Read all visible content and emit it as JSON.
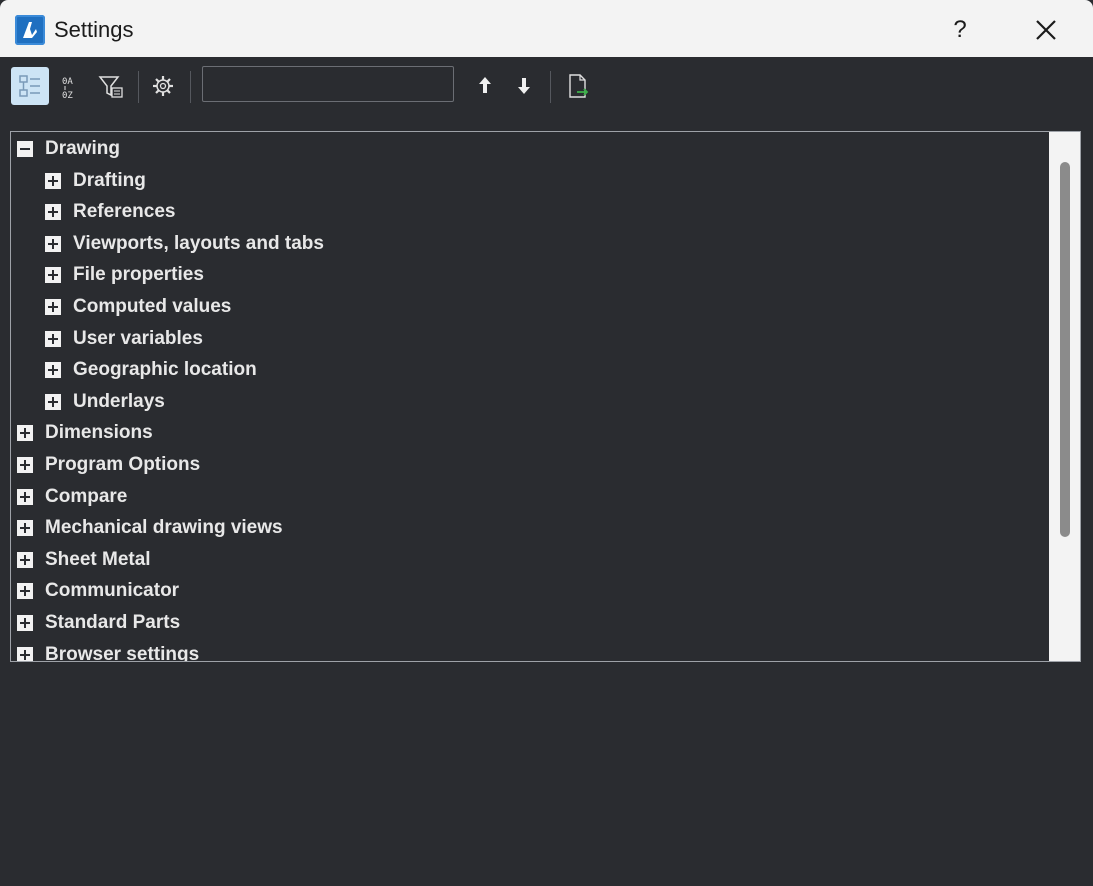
{
  "window": {
    "title": "Settings",
    "help_label": "?"
  },
  "toolbar": {
    "buttons": [
      {
        "name": "categorized-view-icon",
        "active": true
      },
      {
        "name": "alphabetical-sort-icon",
        "active": false
      },
      {
        "name": "filter-icon",
        "active": false
      },
      {
        "name": "gear-icon",
        "active": false
      },
      {
        "name": "arrow-up-icon",
        "active": false
      },
      {
        "name": "arrow-down-icon",
        "active": false
      },
      {
        "name": "export-icon",
        "active": false
      }
    ],
    "search": {
      "value": "",
      "placeholder": ""
    }
  },
  "tree": {
    "items": [
      {
        "label": "Drawing",
        "level": 0,
        "expanded": true
      },
      {
        "label": "Drafting",
        "level": 1,
        "expanded": false
      },
      {
        "label": "References",
        "level": 1,
        "expanded": false
      },
      {
        "label": "Viewports, layouts and tabs",
        "level": 1,
        "expanded": false
      },
      {
        "label": "File properties",
        "level": 1,
        "expanded": false
      },
      {
        "label": "Computed values",
        "level": 1,
        "expanded": false
      },
      {
        "label": "User variables",
        "level": 1,
        "expanded": false
      },
      {
        "label": "Geographic location",
        "level": 1,
        "expanded": false
      },
      {
        "label": "Underlays",
        "level": 1,
        "expanded": false
      },
      {
        "label": "Dimensions",
        "level": 0,
        "expanded": false
      },
      {
        "label": "Program Options",
        "level": 0,
        "expanded": false
      },
      {
        "label": "Compare",
        "level": 0,
        "expanded": false
      },
      {
        "label": "Mechanical drawing views",
        "level": 0,
        "expanded": false
      },
      {
        "label": "Sheet Metal",
        "level": 0,
        "expanded": false
      },
      {
        "label": "Communicator",
        "level": 0,
        "expanded": false
      },
      {
        "label": "Standard Parts",
        "level": 0,
        "expanded": false
      },
      {
        "label": "Browser settings",
        "level": 0,
        "expanded": false
      }
    ]
  },
  "colors": {
    "background": "#2a2c30",
    "titlebar": "#f3f3f3",
    "accent": "#1f6fc0",
    "active_button": "#cde4f5",
    "tree_text": "#e8e8e8"
  }
}
